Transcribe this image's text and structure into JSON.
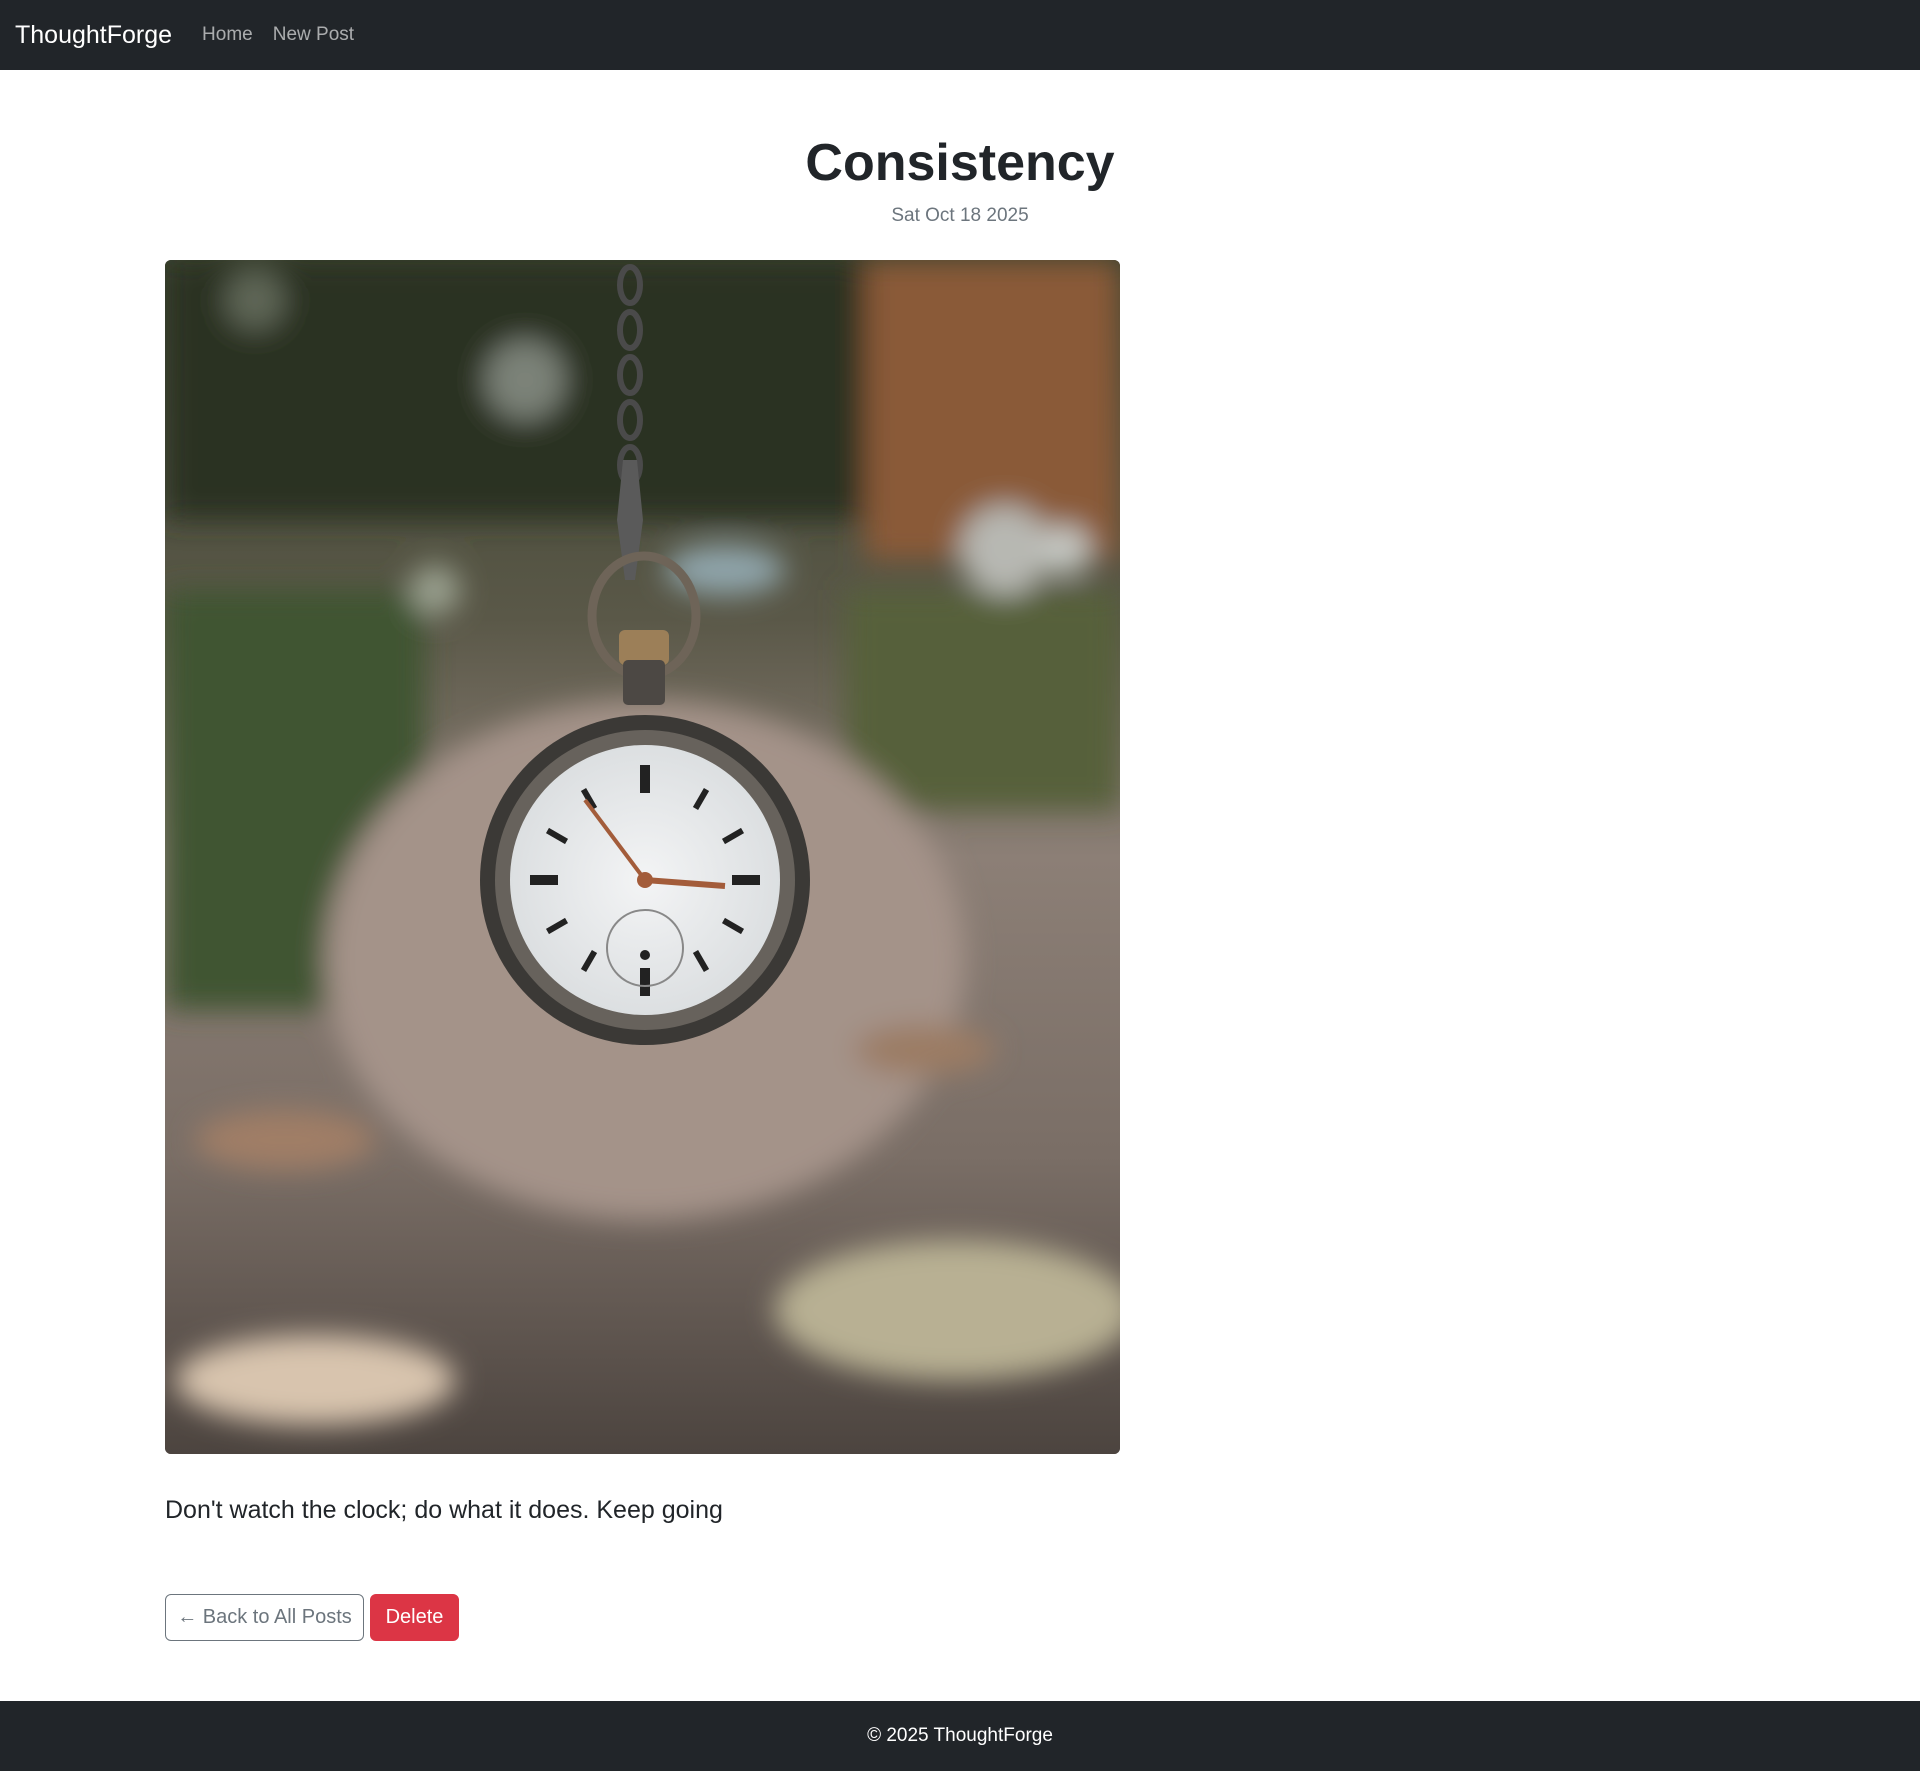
{
  "navbar": {
    "brand": "ThoughtForge",
    "links": [
      "Home",
      "New Post"
    ]
  },
  "post": {
    "title": "Consistency",
    "date": "Sat Oct 18 2025",
    "image_subject": "pocket-watch-photo",
    "body": "Don't watch the clock; do what it does. Keep going"
  },
  "actions": {
    "back_label": "← Back to All Posts",
    "delete_label": "Delete"
  },
  "footer": {
    "text": "© 2025 ThoughtForge"
  },
  "colors": {
    "navbar_bg": "#212529",
    "danger": "#dc3545",
    "secondary": "#6c757d"
  }
}
